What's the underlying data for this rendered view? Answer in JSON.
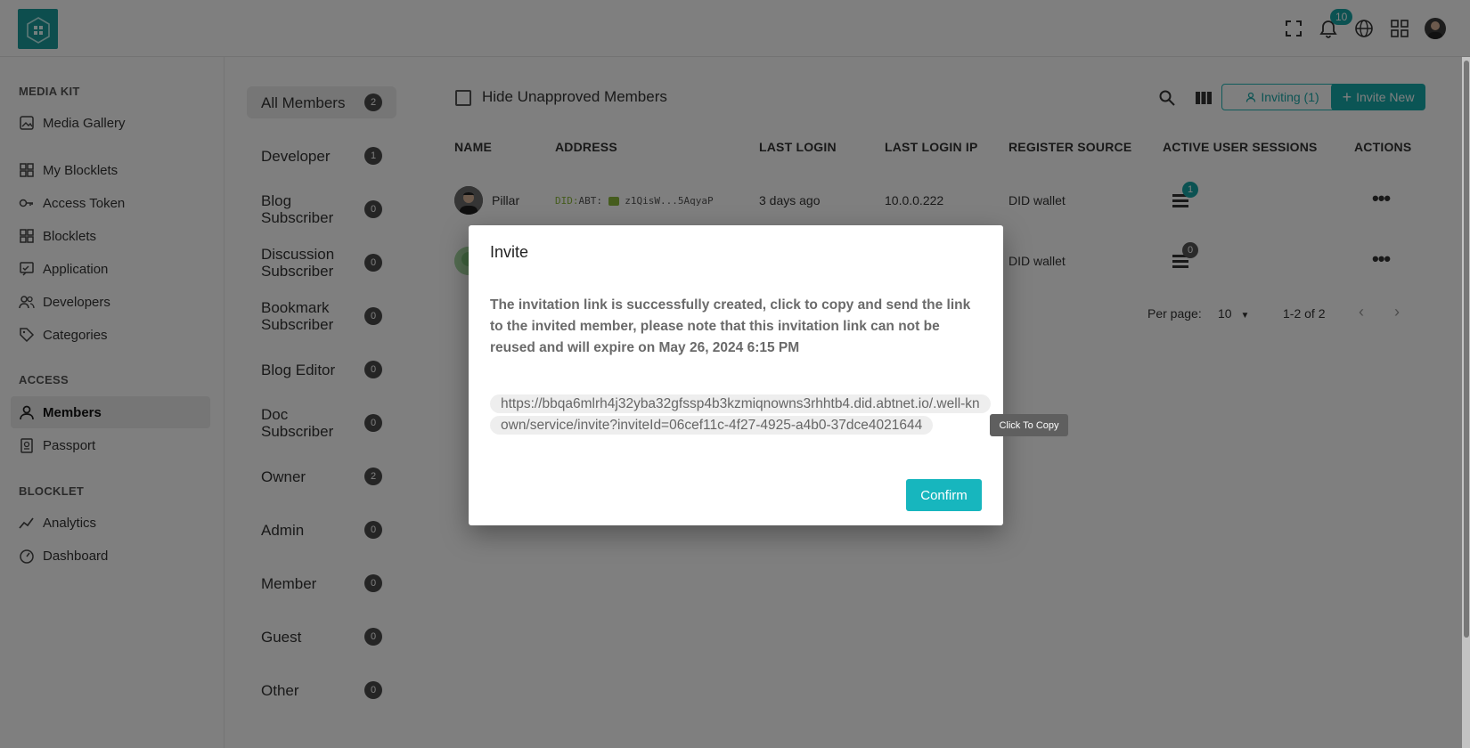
{
  "header": {
    "notification_count": "10"
  },
  "sidebar": {
    "sections": [
      {
        "title": "MEDIA KIT"
      },
      {
        "title": "ACCESS"
      },
      {
        "title": "BLOCKLET"
      }
    ],
    "items": [
      {
        "label": "Media Gallery",
        "icon": "image-icon"
      },
      {
        "label": "My Blocklets",
        "icon": "grid-icon"
      },
      {
        "label": "Access Token",
        "icon": "key-icon"
      },
      {
        "label": "Blocklets",
        "icon": "grid-icon"
      },
      {
        "label": "Application",
        "icon": "app-icon"
      },
      {
        "label": "Developers",
        "icon": "users-icon"
      },
      {
        "label": "Categories",
        "icon": "tag-icon"
      },
      {
        "label": "Members",
        "icon": "user-icon",
        "active": true
      },
      {
        "label": "Passport",
        "icon": "passport-icon"
      },
      {
        "label": "Analytics",
        "icon": "chart-line-icon"
      },
      {
        "label": "Dashboard",
        "icon": "dashboard-icon"
      }
    ]
  },
  "roles": [
    {
      "label": "All Members",
      "count": "2"
    },
    {
      "label": "Developer",
      "count": "1"
    },
    {
      "label": "Blog Subscriber",
      "count": "0"
    },
    {
      "label": "Discussion Subscriber",
      "count": "0"
    },
    {
      "label": "Bookmark Subscriber",
      "count": "0"
    },
    {
      "label": "Blog Editor",
      "count": "0"
    },
    {
      "label": "Doc Subscriber",
      "count": "0"
    },
    {
      "label": "Owner",
      "count": "2"
    },
    {
      "label": "Admin",
      "count": "0"
    },
    {
      "label": "Member",
      "count": "0"
    },
    {
      "label": "Guest",
      "count": "0"
    },
    {
      "label": "Other",
      "count": "0"
    }
  ],
  "toolbar": {
    "hide_unapproved_label": "Hide Unapproved Members",
    "inviting_label": "Inviting (1)",
    "invite_new_label": "Invite New"
  },
  "table": {
    "columns": [
      "NAME",
      "ADDRESS",
      "LAST LOGIN",
      "LAST LOGIN IP",
      "REGISTER SOURCE",
      "ACTIVE USER SESSIONS",
      "ACTIONS"
    ],
    "rows": [
      {
        "name": "Pillar",
        "address_prefix": "DID:",
        "address_rest": "ABT:",
        "address_short": "z1QisW...5AqyaP",
        "last_login": "3 days ago",
        "ip": "10.0.0.222",
        "source": "DID wallet",
        "sessions": "1"
      },
      {
        "name": "",
        "address_prefix": "",
        "address_rest": "",
        "address_short": "",
        "last_login": "",
        "ip": "",
        "source": "DID wallet",
        "sessions": "0"
      }
    ]
  },
  "pagination": {
    "per_page_label": "Per page:",
    "per_page_value": "10",
    "range": "1-2 of 2"
  },
  "dialog": {
    "title": "Invite",
    "message": "The invitation link is successfully created, click to copy and send the link to the invited member, please note that this invitation link can not be reused and will expire on May 26, 2024 6:15 PM",
    "link": "https://bbqa6mlrh4j32yba32gfssp4b3kzmiqnowns3rhhtb4.did.abtnet.io/.well-known/service/invite?inviteId=06cef11c-4f27-4925-a4b0-37dce4021644",
    "confirm_label": "Confirm",
    "tooltip": "Click To Copy"
  }
}
